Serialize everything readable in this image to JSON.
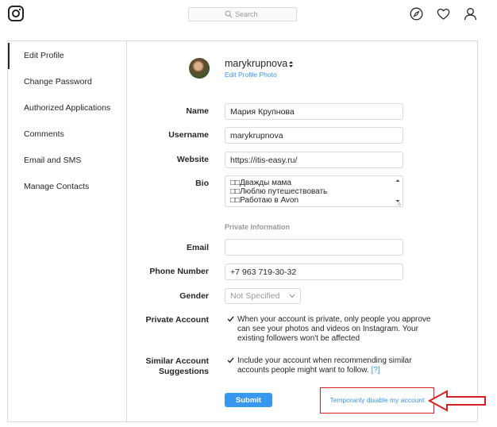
{
  "search": {
    "placeholder": "Search"
  },
  "nav_icons": [
    "instagram-logo-icon",
    "compass-icon",
    "heart-icon",
    "profile-icon"
  ],
  "sidebar": {
    "items": [
      {
        "label": "Edit Profile",
        "active": true
      },
      {
        "label": "Change Password"
      },
      {
        "label": "Authorized Applications"
      },
      {
        "label": "Comments"
      },
      {
        "label": "Email and SMS"
      },
      {
        "label": "Manage Contacts"
      }
    ]
  },
  "profile": {
    "username": "marykrupnova",
    "edit_photo_label": "Edit Profile Photo"
  },
  "form": {
    "name": {
      "label": "Name",
      "value": "Мария Крупнова"
    },
    "username": {
      "label": "Username",
      "value": "marykrupnova"
    },
    "website": {
      "label": "Website",
      "value": "https://itis-easy.ru/"
    },
    "bio": {
      "label": "Bio",
      "lines": [
        "□□Дважды мама",
        "□□Люблю путешествовать",
        "□□Работаю в Avon"
      ]
    },
    "private_info_title": "Private Information",
    "email": {
      "label": "Email",
      "value": ""
    },
    "phone": {
      "label": "Phone Number",
      "value": "+7 963 719-30-32"
    },
    "gender": {
      "label": "Gender",
      "value": "Not Specified"
    },
    "private_account": {
      "label": "Private Account",
      "checked": true,
      "text": "When your account is private, only people you approve can see your photos and videos on Instagram. Your existing followers won't be affected"
    },
    "similar_suggestions": {
      "label_line1": "Similar Account",
      "label_line2": "Suggestions",
      "checked": true,
      "text": "Include your account when recommending similar accounts people might want to follow.",
      "help": "[?]"
    },
    "submit_label": "Submit",
    "disable_label": "Temporarily disable my account"
  },
  "colors": {
    "accent": "#3897f0",
    "border": "#dbdbdb",
    "annotation": "#d32020"
  }
}
